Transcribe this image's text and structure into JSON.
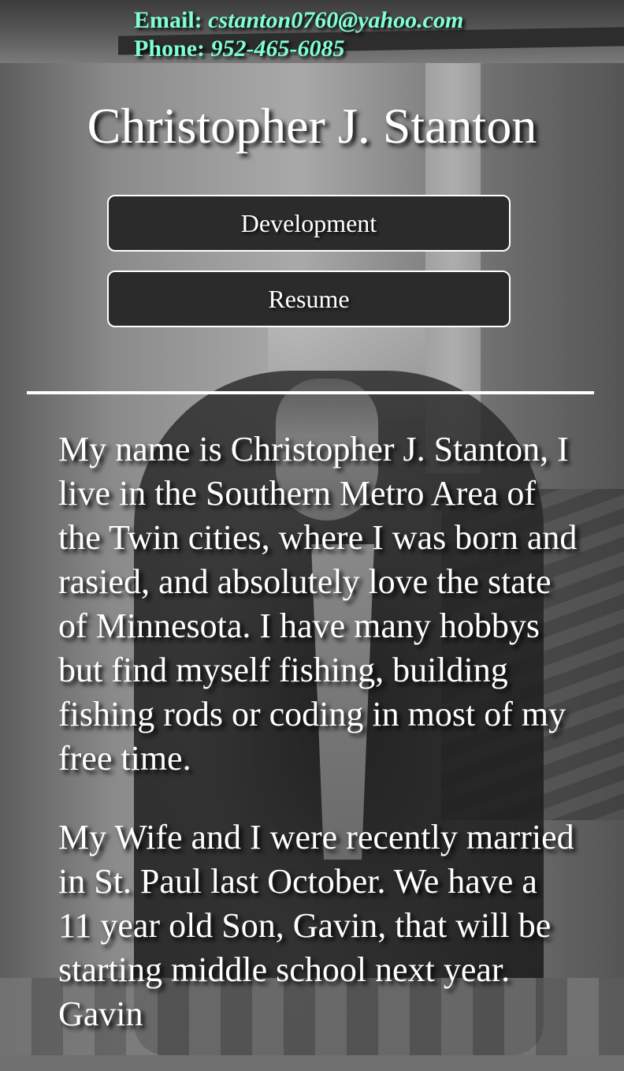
{
  "contact": {
    "email_label": "Email:",
    "email": "cstanton0760@yahoo.com",
    "phone_label": "Phone:",
    "phone": "952-465-6085"
  },
  "header": {
    "name": "Christopher J. Stanton"
  },
  "nav": {
    "development_label": "Development",
    "resume_label": "Resume"
  },
  "bio": {
    "paragraph1": "My name is Christopher J. Stanton, I live in the Southern Metro Area of the Twin cities, where I was born and rasied, and absolutely love the state of Minnesota. I have many hobbys but find myself fishing, building fishing rods or coding in most of my free time.",
    "paragraph2": "My Wife and I were recently married in St. Paul last October. We have a 11 year old Son, Gavin, that will be starting middle school next year. Gavin"
  },
  "colors": {
    "contact_text": "#7fffd4",
    "button_bg": "#2b2b2b",
    "text": "#ffffff"
  }
}
